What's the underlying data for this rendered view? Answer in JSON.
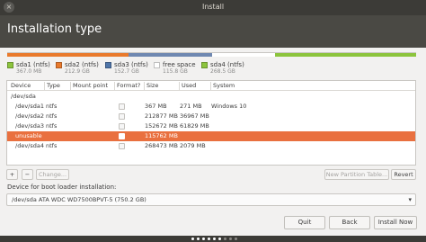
{
  "window": {
    "title": "Install",
    "close_glyph": "×"
  },
  "header": {
    "title": "Installation type"
  },
  "partition_bar": {
    "segments": [
      {
        "name": "sda1",
        "color": "#e97a2c",
        "fraction": 0.013
      },
      {
        "name": "sda2",
        "color": "#e97a2c",
        "fraction": 0.284
      },
      {
        "name": "sda3",
        "color": "#6f88b1",
        "fraction": 0.204
      },
      {
        "name": "free",
        "color": "#ffffff",
        "fraction": 0.154
      },
      {
        "name": "sda4",
        "color": "#8cc43d",
        "fraction": 0.345
      }
    ]
  },
  "legend": [
    {
      "label": "sda1 (ntfs)",
      "size": "367.0 MB",
      "color": "#8cc43d"
    },
    {
      "label": "sda2 (ntfs)",
      "size": "212.9 GB",
      "color": "#e97a2c"
    },
    {
      "label": "sda3 (ntfs)",
      "size": "152.7 GB",
      "color": "#4f75a8"
    },
    {
      "label": "free space",
      "size": "115.8 GB",
      "color": "#ffffff"
    },
    {
      "label": "sda4 (ntfs)",
      "size": "268.5 GB",
      "color": "#8cc43d"
    }
  ],
  "table": {
    "columns": [
      "Device",
      "Type",
      "Mount point",
      "Format?",
      "Size",
      "Used",
      "System"
    ],
    "rows": [
      {
        "device": "/dev/sda",
        "type": "",
        "mount": "",
        "format": false,
        "show_check": false,
        "size": "",
        "used": "",
        "system": "",
        "selected": false
      },
      {
        "device": "/dev/sda1",
        "type": "ntfs",
        "mount": "",
        "format": false,
        "show_check": true,
        "size": "367 MB",
        "used": "271 MB",
        "system": "Windows 10",
        "selected": false
      },
      {
        "device": "/dev/sda2",
        "type": "ntfs",
        "mount": "",
        "format": false,
        "show_check": true,
        "size": "212877 MB",
        "used": "36967 MB",
        "system": "",
        "selected": false
      },
      {
        "device": "/dev/sda3",
        "type": "ntfs",
        "mount": "",
        "format": false,
        "show_check": true,
        "size": "152672 MB",
        "used": "61829 MB",
        "system": "",
        "selected": false
      },
      {
        "device": "unusable",
        "type": "",
        "mount": "",
        "format": false,
        "show_check": true,
        "size": "115762 MB",
        "used": "",
        "system": "",
        "selected": true
      },
      {
        "device": "/dev/sda4",
        "type": "ntfs",
        "mount": "",
        "format": false,
        "show_check": true,
        "size": "268473 MB",
        "used": "2079 MB",
        "system": "",
        "selected": false
      }
    ]
  },
  "toolbar": {
    "add_label": "+",
    "remove_label": "−",
    "change_label": "Change...",
    "new_table_label": "New Partition Table...",
    "revert_label": "Revert"
  },
  "bootloader": {
    "label": "Device for boot loader installation:",
    "value": "/dev/sda   ATA WDC WD7500BPVT-5 (750.2 GB)",
    "arrow": "▾"
  },
  "buttons": {
    "quit": "Quit",
    "back": "Back",
    "install_now": "Install Now"
  },
  "progress_dots": {
    "total": 9,
    "done": 6,
    "done_color": "#ffffff",
    "todo_color": "#8a8883"
  }
}
